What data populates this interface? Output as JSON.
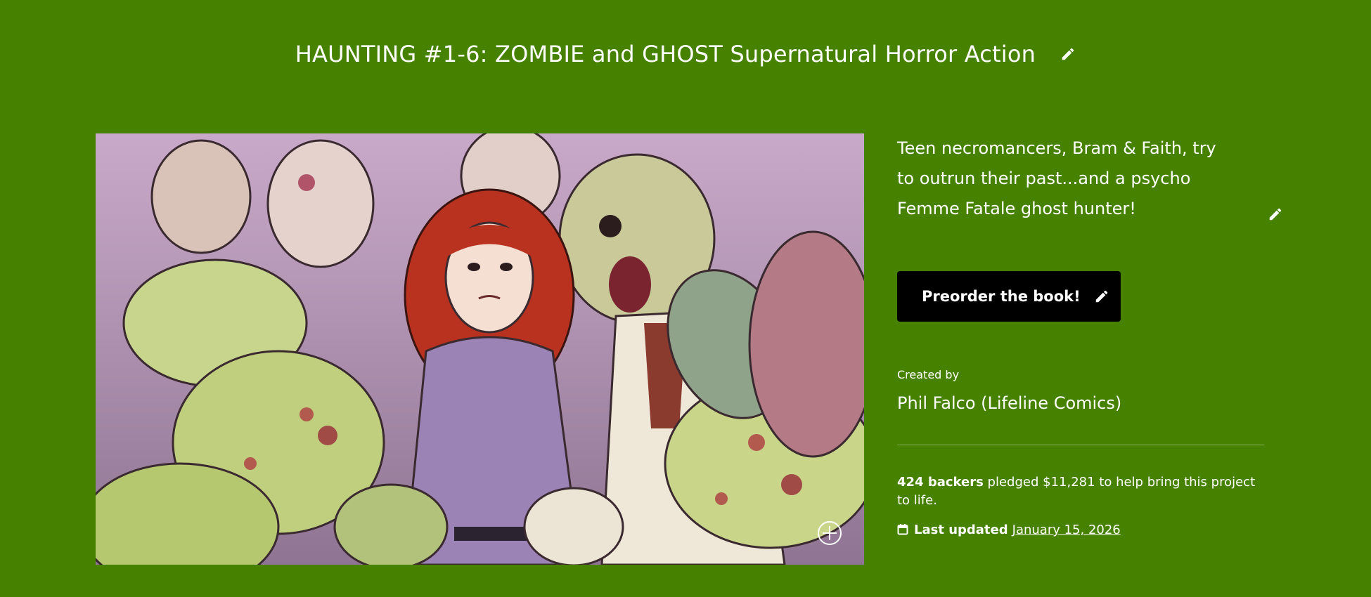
{
  "header": {
    "title": "HAUNTING #1-6: ZOMBIE and GHOST Supernatural Horror Action",
    "edit_icon": "pencil-icon"
  },
  "hero": {
    "image_subject": "illustration",
    "expand_icon": "plus-circle-icon"
  },
  "sidebar": {
    "blurb": "Teen necromancers, Bram & Faith, try to outrun their past...and a psycho Femme Fatale ghost hunter!",
    "cta_label": "Preorder the book!",
    "created_by_label": "Created by",
    "creator_name": "Phil Falco (Lifeline Comics)",
    "backers_count": "424 backers",
    "pledge_text": " pledged $11,281 to help bring this project to life.",
    "last_updated_label": "Last updated",
    "last_updated_date": "January 15, 2026",
    "calendar_icon": "calendar-icon"
  },
  "colors": {
    "background": "#468200",
    "cta_background": "#000000",
    "text": "#ffffff"
  }
}
